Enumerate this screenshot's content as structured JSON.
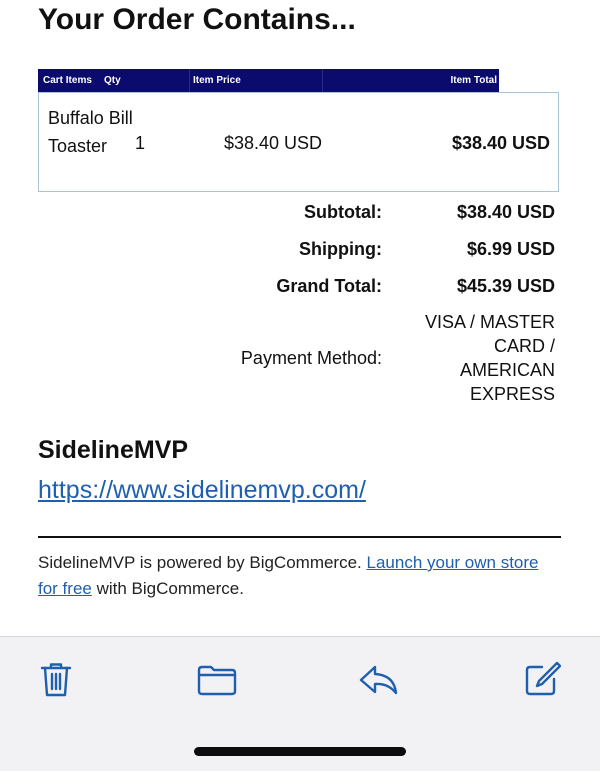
{
  "email": {
    "heading": "Your Order Contains...",
    "table_headers": {
      "cart_items": "Cart Items",
      "qty": "Qty",
      "item_price": "Item Price",
      "item_total": "Item Total"
    },
    "items": [
      {
        "name": "Buffalo Bill Toaster",
        "qty": "1",
        "price": "$38.40 USD",
        "total": "$38.40 USD"
      }
    ],
    "summary": {
      "subtotal_label": "Subtotal:",
      "subtotal_value": "$38.40 USD",
      "shipping_label": "Shipping:",
      "shipping_value": "$6.99 USD",
      "grand_total_label": "Grand Total:",
      "grand_total_value": "$45.39 USD",
      "payment_label": "Payment Method:",
      "payment_value": "VISA / MASTER CARD / AMERICAN EXPRESS"
    },
    "store": {
      "name": "SidelineMVP",
      "url": "https://www.sidelinemvp.com/"
    },
    "footer": {
      "text_before": "SidelineMVP is powered by BigCommerce. ",
      "link_text": "Launch your own store for free",
      "text_after": " with BigCommerce."
    }
  },
  "toolbar": {
    "accent_color": "#1f5fae",
    "buttons": [
      {
        "name": "delete",
        "icon": "trash-icon"
      },
      {
        "name": "move",
        "icon": "folder-icon"
      },
      {
        "name": "reply",
        "icon": "reply-icon"
      },
      {
        "name": "compose",
        "icon": "compose-icon"
      }
    ]
  }
}
